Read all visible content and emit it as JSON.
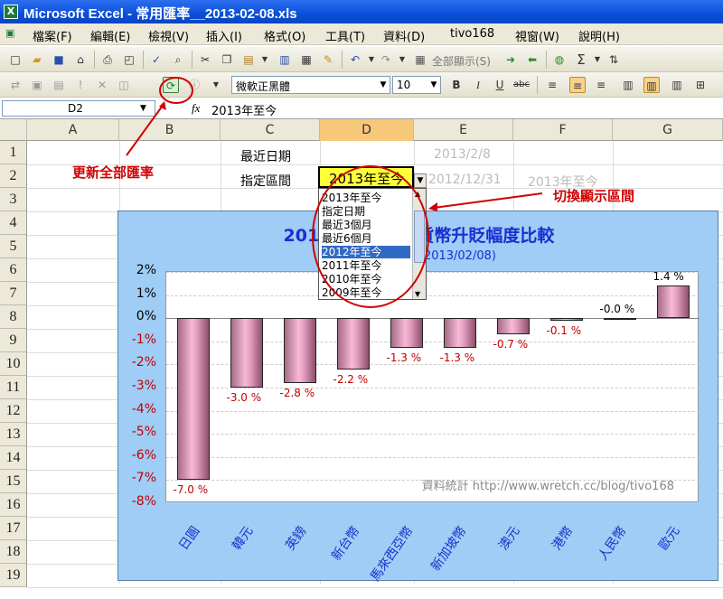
{
  "window": {
    "title": "Microsoft Excel - 常用匯率__2013-02-08.xls"
  },
  "menu": [
    "檔案(F)",
    "編輯(E)",
    "檢視(V)",
    "插入(I)",
    "格式(O)",
    "工具(T)",
    "資料(D)",
    "tivo168",
    "視窗(W)",
    "說明(H)"
  ],
  "toolbar": {
    "show_all": "全部顯示(S)",
    "font": "微軟正黑體",
    "size": "10"
  },
  "formula": {
    "cell": "D2",
    "content": "2013年至今"
  },
  "columns": [
    "A",
    "B",
    "C",
    "D",
    "E",
    "F",
    "G"
  ],
  "rows": [
    "1",
    "2",
    "3",
    "4",
    "5",
    "6",
    "7",
    "8",
    "9",
    "10",
    "11",
    "12",
    "13",
    "14",
    "15",
    "16",
    "17",
    "18",
    "19"
  ],
  "cells": {
    "c1": "最近日期",
    "e1": "2013/2/8",
    "c2": "指定區間",
    "d2": "2013年至今",
    "e2": "2012/12/31",
    "f2": "2013年至今"
  },
  "dropdown": {
    "items": [
      "2013年至今",
      "指定日期",
      "最近3個月",
      "最近6個月",
      "2012年至今",
      "2011年至今",
      "2010年至今",
      "2009年至今"
    ],
    "selected_index": 4
  },
  "annotations": {
    "refresh": "更新全部匯率",
    "switch": "切換顯示區間"
  },
  "chart_data": {
    "type": "bar",
    "title": "2013年至今各國貨幣升貶幅度比較",
    "subtitle": "(2012/12/31~2013/02/08)",
    "categories": [
      "日圓",
      "韓元",
      "英鎊",
      "新台幣",
      "馬來西亞幣",
      "新加坡幣",
      "澳元",
      "港幣",
      "人民幣",
      "歐元"
    ],
    "values": [
      -7.0,
      -3.0,
      -2.8,
      -2.2,
      -1.3,
      -1.3,
      -0.7,
      -0.1,
      -0.0,
      1.4
    ],
    "labels": [
      "-7.0 %",
      "-3.0 %",
      "-2.8 %",
      "-2.2 %",
      "-1.3 %",
      "-1.3 %",
      "-0.7 %",
      "-0.1 %",
      "-0.0 %",
      "1.4 %"
    ],
    "yticks": [
      "2%",
      "1%",
      "0%",
      "-1%",
      "-2%",
      "-3%",
      "-4%",
      "-5%",
      "-6%",
      "-7%",
      "-8%"
    ],
    "ylim": [
      -8,
      2
    ],
    "watermark": "資料統計 http://www.wretch.cc/blog/tivo168",
    "grid": true,
    "colors": {
      "bar": "#e6a2c2",
      "background": "#9fcdf5",
      "axis_labels": "#1a2fd0",
      "data_labels": "#c00000"
    }
  }
}
